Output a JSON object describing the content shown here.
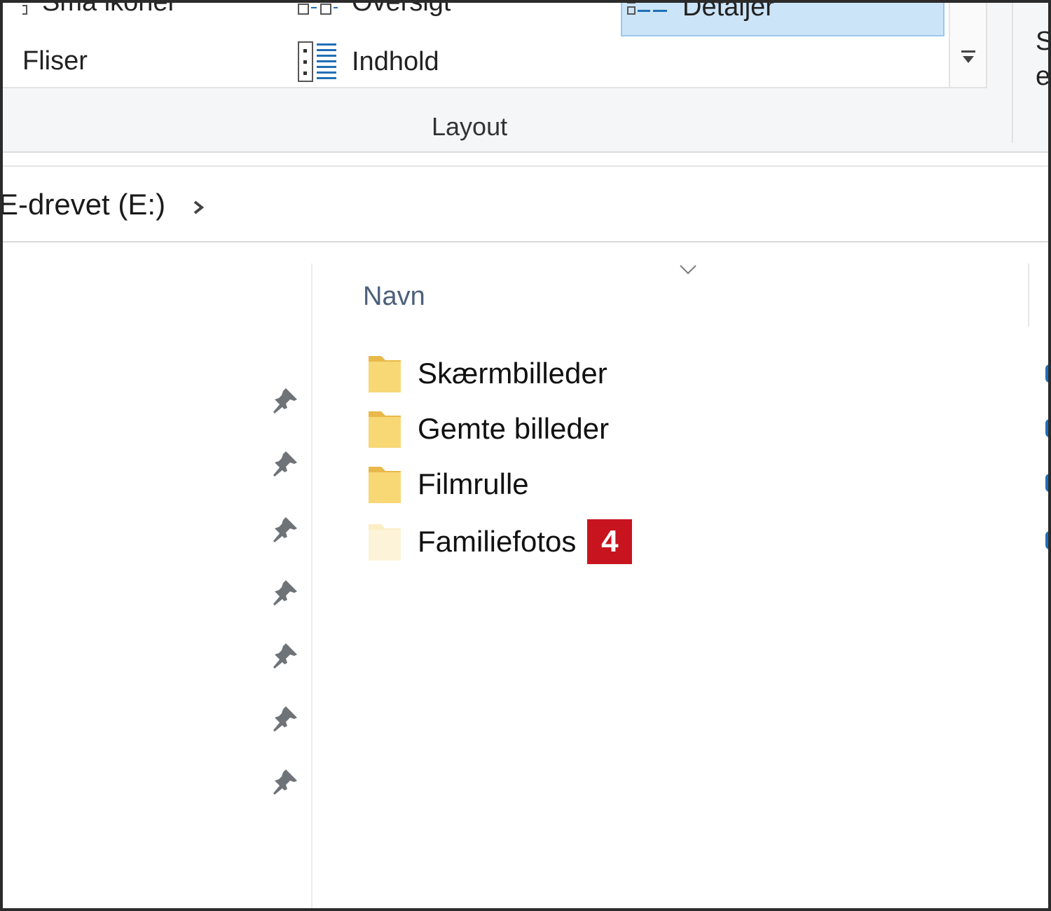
{
  "ribbon": {
    "gallery": {
      "small_icons": "Små ikoner",
      "overview": "Oversigt",
      "details": "Detaljer",
      "tiles": "Fliser",
      "content": "Indhold"
    },
    "group_label": "Layout",
    "cut_labels": [
      "S",
      "e"
    ]
  },
  "address": {
    "crumb": "E-drevet (E:)"
  },
  "file_list": {
    "column_header": "Navn",
    "items": [
      {
        "name": "Skærmbilleder"
      },
      {
        "name": "Gemte billeder"
      },
      {
        "name": "Filmrulle"
      },
      {
        "name": "Familiefotos",
        "badge": "4"
      }
    ]
  },
  "colors": {
    "selection": "#cce4f7",
    "folder": "#f8d775",
    "badge": "#c8141e",
    "pin": "#6e7378"
  },
  "icons": {
    "pin": "pin-icon",
    "folder": "folder-icon",
    "chevron": "chevron-right-icon"
  }
}
